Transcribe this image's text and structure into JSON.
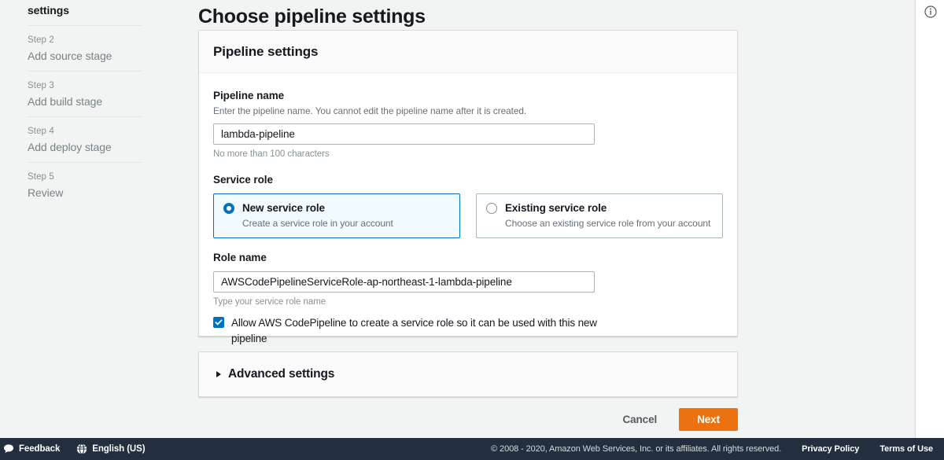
{
  "page": {
    "title": "Choose pipeline settings"
  },
  "sidebar": {
    "steps": [
      {
        "num": "",
        "label": "settings",
        "active": true
      },
      {
        "num": "Step 2",
        "label": "Add source stage",
        "active": false
      },
      {
        "num": "Step 3",
        "label": "Add build stage",
        "active": false
      },
      {
        "num": "Step 4",
        "label": "Add deploy stage",
        "active": false
      },
      {
        "num": "Step 5",
        "label": "Review",
        "active": false
      }
    ]
  },
  "settings_card": {
    "header": "Pipeline settings",
    "pipeline_name": {
      "label": "Pipeline name",
      "description": "Enter the pipeline name. You cannot edit the pipeline name after it is created.",
      "value": "lambda-pipeline",
      "hint": "No more than 100 characters"
    },
    "service_role": {
      "label": "Service role",
      "options": [
        {
          "title": "New service role",
          "subtitle": "Create a service role in your account",
          "selected": true
        },
        {
          "title": "Existing service role",
          "subtitle": "Choose an existing service role from your account",
          "selected": false
        }
      ]
    },
    "role_name": {
      "label": "Role name",
      "value": "AWSCodePipelineServiceRole-ap-northeast-1-lambda-pipeline",
      "hint": "Type your service role name"
    },
    "allow_checkbox": {
      "label": "Allow AWS CodePipeline to create a service role so it can be used with this new pipeline",
      "checked": true
    }
  },
  "advanced": {
    "title": "Advanced settings",
    "expanded": false
  },
  "actions": {
    "cancel_label": "Cancel",
    "next_label": "Next"
  },
  "help_panel": {
    "info_icon": "info-icon"
  },
  "footer": {
    "feedback_label": "Feedback",
    "language_label": "English (US)",
    "copyright": "© 2008 - 2020, Amazon Web Services, Inc. or its affiliates. All rights reserved.",
    "privacy_label": "Privacy Policy",
    "terms_label": "Terms of Use"
  },
  "colors": {
    "accent_blue": "#0073bb",
    "primary_orange": "#ec7211",
    "footer_bg": "#232f3e",
    "page_bg": "#f2f3f3"
  }
}
